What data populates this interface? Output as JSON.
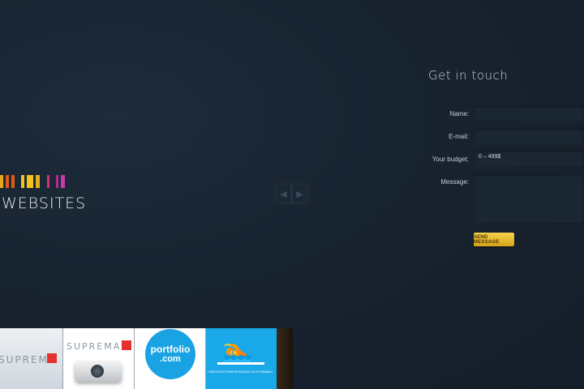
{
  "brand": {
    "text": "WEBSITES",
    "stripe_colors": [
      "#e8a31c",
      "#e05a18",
      "#f2c31d",
      "#f2c31d",
      "#e3b024",
      "#c9327a",
      "#b02a98",
      "#c43ca8"
    ]
  },
  "slider": {
    "prev_icon": "chevron-left-icon",
    "next_icon": "chevron-right-icon",
    "prev_glyph": "◀",
    "next_glyph": "▶"
  },
  "contact": {
    "title": "Get in touch",
    "name_label": "Name:",
    "email_label": "E-mail:",
    "budget_label": "Your budget:",
    "budget_value": "0 – 499$",
    "message_label": "Message:",
    "send_label": "SEND MESSAGE"
  },
  "portfolio": {
    "items": [
      {
        "logo": "SUPREMA"
      },
      {
        "logo": "SUPREMA"
      },
      {
        "logo_line1": "portfolio",
        "logo_line2": ".com"
      },
      {
        "caption": "I MISTRZOSTWA WYDZIAŁU W PŁYWANIU"
      },
      {}
    ]
  },
  "colors": {
    "accent_button": "#f2c634",
    "background": "#17222e",
    "swim_blue": "#1aa9e8"
  }
}
